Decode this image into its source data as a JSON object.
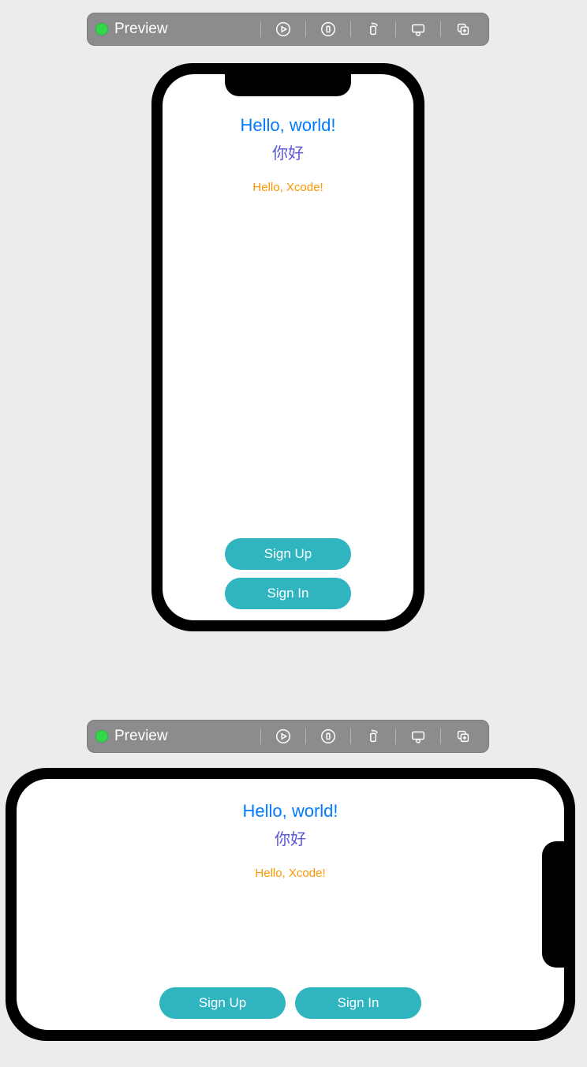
{
  "toolbar": {
    "label": "Preview"
  },
  "app": {
    "hello": "Hello, world!",
    "nihao": "你好",
    "xcode": "Hello, Xcode!",
    "signup": "Sign Up",
    "signin": "Sign In"
  },
  "colors": {
    "hello": "#007aff",
    "nihao": "#5856d6",
    "xcode": "#ff9500",
    "button_bg": "#2fb4c0",
    "toolbar_bg": "#8c8c8e",
    "status_dot": "#32d74b"
  }
}
